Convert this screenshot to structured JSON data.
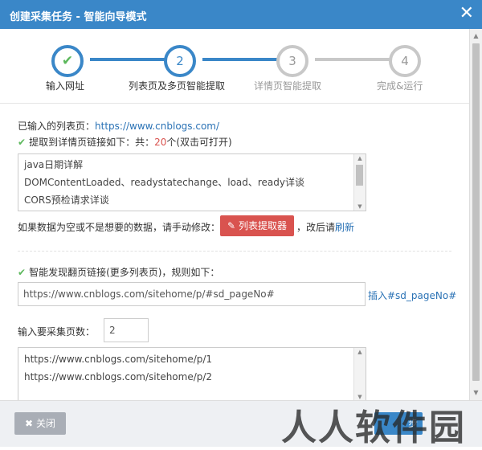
{
  "window": {
    "title": "创建采集任务 - 智能向导模式",
    "close_glyph": "✕"
  },
  "steps": [
    {
      "number": "✔",
      "label": "输入网址",
      "state": "done"
    },
    {
      "number": "2",
      "label": "列表页及多页智能提取",
      "state": "active"
    },
    {
      "number": "3",
      "label": "详情页智能提取",
      "state": "pending"
    },
    {
      "number": "4",
      "label": "完成&运行",
      "state": "pending"
    }
  ],
  "list_section": {
    "entered_label": "已输入的列表页：",
    "entered_url": "https://www.cnblogs.com/",
    "extracted_text_pre": "提取到详情页链接如下：共：",
    "extracted_count": "20",
    "extracted_text_post": "个(双击可打开)",
    "items": [
      "java日期详解",
      "DOMContentLoaded、readystatechange、load、ready详谈",
      "CORS预检请求详谈"
    ],
    "hint_text": "如果数据为空或不是想要的数据，请手动修改：",
    "extractor_button": "列表提取器",
    "after_text": "，改后请",
    "refresh_link": "刷新"
  },
  "paging_section": {
    "found_text": "智能发现翻页链接(更多列表页)，规则如下：",
    "rule_value": "https://www.cnblogs.com/sitehome/p/#sd_pageNo#",
    "insert_link": "插入#sd_pageNo#",
    "page_count_label": "输入要采集页数：",
    "page_count_value": "2",
    "generated_urls": [
      "https://www.cnblogs.com/sitehome/p/1",
      "https://www.cnblogs.com/sitehome/p/2"
    ]
  },
  "footer": {
    "close_button": "关闭",
    "next_button_peek": "步",
    "close_icon": "✖"
  },
  "watermark": "人人软件园",
  "icons": {
    "check": "✔",
    "pencil": "✎",
    "arrow_up": "▲",
    "arrow_down": "▼"
  },
  "colors": {
    "title_bar": "#3a87c8",
    "accent": "#3a87c8",
    "success": "#5cb85c",
    "danger": "#d9534f",
    "link": "#2a72b5"
  }
}
